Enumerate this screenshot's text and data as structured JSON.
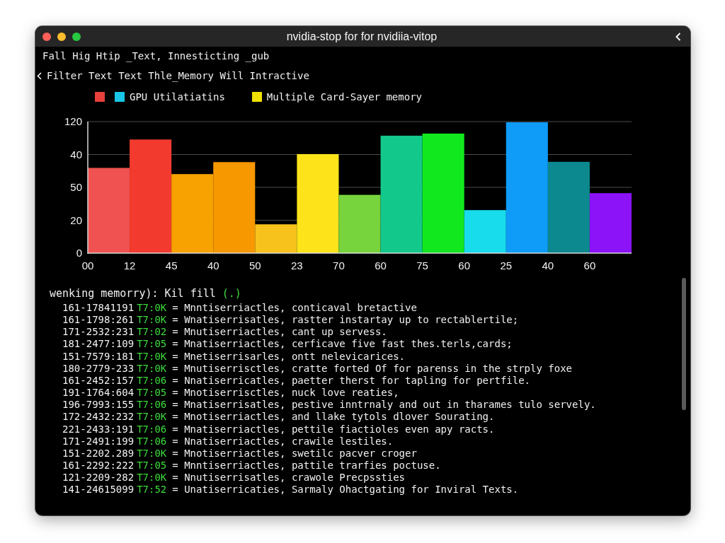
{
  "window": {
    "title": "nvidia-stop for for nvidiia-vitop"
  },
  "info_line": "Fall Hig Htip _Text, Innesticting _gub",
  "filter": {
    "label": "Filter Text Text Thle_Memory Will Intractive"
  },
  "legend": [
    {
      "color": "#e8403a"
    },
    {
      "color": "#19c6e6",
      "label": "GPU Utilatiatins"
    },
    {
      "color": "#f0e000",
      "label": "Multiple Card-Sayer memory"
    }
  ],
  "chart": {
    "y_labels": [
      "120",
      "40",
      "50",
      "20",
      "0"
    ],
    "x_labels": [
      "00",
      "12",
      "45",
      "40",
      "50",
      "23",
      "70",
      "60",
      "75",
      "60",
      "25",
      "40",
      "60"
    ]
  },
  "log": {
    "title": "wenking memorry): Kil fill",
    "status": "(.)",
    "rows": [
      {
        "id": "161-17841191",
        "code": "T7:0K",
        "message": "= Mnntiserriactles, conticaval bretactive"
      },
      {
        "id": "161-1798:261",
        "code": "T7:0K",
        "message": "= Wnatiserrisatles, rastter instartay up to rectablertile;"
      },
      {
        "id": "171-2532:231",
        "code": "T7:02",
        "message": "= Mnutiserriactles, cant up servess."
      },
      {
        "id": "181-2477:109",
        "code": "T7:05",
        "message": "= Mnatiserriactles, cerficave five fast thes.terls,cards;"
      },
      {
        "id": "151-7579:181",
        "code": "T7:0K",
        "message": "= Mnetiserrisarles, ontt nelevicarices."
      },
      {
        "id": "180-2779-233",
        "code": "T7:0K",
        "message": "= Mnutiserrisctles, cratte forted Of for parenss in the strply foxe"
      },
      {
        "id": "161-2452:157",
        "code": "T7:06",
        "message": "= Nnatiserricatles, paetter therst for tapling for pertfile."
      },
      {
        "id": "191-1764:604",
        "code": "T7:05",
        "message": "= Mnotiserrisctles, nuck love reaties,"
      },
      {
        "id": "196-7993:155",
        "code": "T7:06",
        "message": "= Mnatiserrisatles, pestive inntrnaly and out in tharames tulo servely."
      },
      {
        "id": "172-2432:232",
        "code": "T7:0K",
        "message": "= Mnotiserriactles, and llake tytols dlover Sourating."
      },
      {
        "id": "221-2433:191",
        "code": "T7:06",
        "message": "= Mnatiserriactles, pettile fiactioles even apy racts."
      },
      {
        "id": "171-2491:199",
        "code": "T7:06",
        "message": "= Nnatiserriactles, crawile lestiles."
      },
      {
        "id": "151-2202.289",
        "code": "T7:0K",
        "message": "= Mnotiserriactles, swetilc pacver croger"
      },
      {
        "id": "161-2292:222",
        "code": "T7:05",
        "message": "= Mnntiserriactles, pattile trarfies poctuse."
      },
      {
        "id": "121-2209-282",
        "code": "T7:0K",
        "message": "= Nnutiserrisatles, crawole Precpssties"
      },
      {
        "id": "141-24615099",
        "code": "T7:52",
        "message": "= Unatiserricaties, Sarmaly Ohactgating for Inviral Texts."
      }
    ]
  }
}
